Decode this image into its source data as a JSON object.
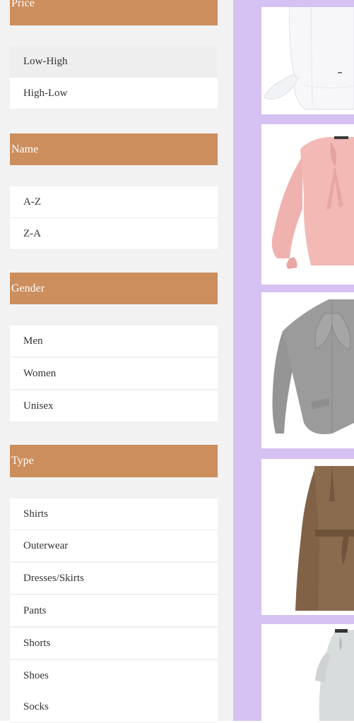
{
  "filters": {
    "price": {
      "title": "Price",
      "options": [
        "Low-High",
        "High-Low"
      ]
    },
    "name": {
      "title": "Name",
      "options": [
        "A-Z",
        "Z-A"
      ]
    },
    "gender": {
      "title": "Gender",
      "options": [
        "Men",
        "Women",
        "Unisex"
      ]
    },
    "type": {
      "title": "Type",
      "options": [
        "Shirts",
        "Outerwear",
        "Dresses/Skirts",
        "Pants",
        "Shorts",
        "Shoes",
        "Socks"
      ]
    }
  },
  "products": [
    {
      "icon": "white-shirt-image",
      "color": "#f7f7f9"
    },
    {
      "icon": "pink-bow-blouse-image",
      "color": "#f2b9b5"
    },
    {
      "icon": "gray-bow-jacket-image",
      "color": "#9b9b9b"
    },
    {
      "icon": "brown-belted-coat-image",
      "color": "#8a6b4e"
    },
    {
      "icon": "gray-dress-image",
      "color": "#d9dcdc"
    }
  ],
  "colors": {
    "header_bg": "#cc8e5d",
    "sidebar_bg": "#f2f2f2",
    "grid_bg": "#d6c2f2"
  }
}
